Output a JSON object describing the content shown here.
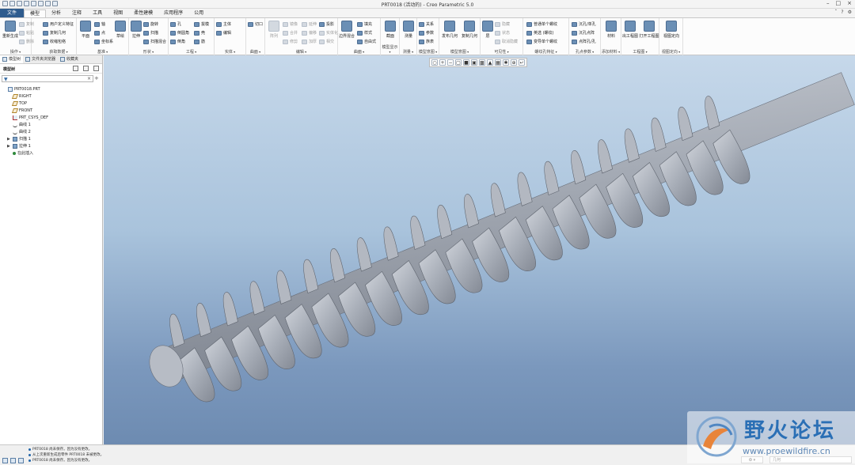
{
  "window": {
    "title": "PRT0018 (活动的) - Creo Parametric 5.0"
  },
  "menu_tabs": [
    {
      "label": "文件",
      "kind": "file"
    },
    {
      "label": "模型",
      "kind": "active"
    },
    {
      "label": "分析"
    },
    {
      "label": "注释"
    },
    {
      "label": "工具"
    },
    {
      "label": "视图"
    },
    {
      "label": "柔性建模"
    },
    {
      "label": "应用程序"
    },
    {
      "label": "公用"
    }
  ],
  "ribbon": {
    "operations": {
      "label": "操作",
      "regen": "重新生成",
      "copy": "复制",
      "paste": "粘贴",
      "delete": "删除"
    },
    "get_data": {
      "label": "获取数据",
      "udf": "用户定义特征",
      "copy_geom": "复制几何",
      "shrinkwrap": "收缩包络"
    },
    "datum": {
      "label": "基准",
      "plane": "平面",
      "axis": "轴",
      "point": "点",
      "csys": "坐标系",
      "sketch": "草绘"
    },
    "shapes": {
      "label": "形状",
      "extrude": "拉伸",
      "revolve": "旋转",
      "sweep": "扫描",
      "swept_blend": "扫描混合"
    },
    "engineering": {
      "label": "工程",
      "hole": "孔",
      "round": "倒圆角",
      "chamfer": "倒角",
      "draft": "拔模",
      "shell": "壳",
      "rib": "筋"
    },
    "solid": {
      "label": "实体",
      "edit": "编辑",
      "advanced": "主体",
      "tab1": "切口"
    },
    "surface": {
      "label": "曲面",
      "fill": "填充",
      "boundary": "边界混合",
      "style": "样式",
      "freestyle": "自由式"
    },
    "editing": {
      "label": "编辑",
      "pattern": "阵列",
      "mirror": "镜像",
      "merge": "合并",
      "trim": "修剪",
      "extend": "延伸",
      "offset": "偏移",
      "thicken": "加厚",
      "solidify": "实体化",
      "intersect": "相交",
      "project": "投影"
    },
    "model_intent": {
      "label": "模型意图",
      "relations": "关系",
      "params": "参数",
      "family": "族表",
      "section": "截面"
    },
    "model_display": {
      "label": "模型显示"
    },
    "measure": {
      "label": "测量",
      "btn": "测量"
    },
    "publish": {
      "label": "模型意图",
      "pub_geom": "发布几何",
      "copy_geom": "复制几何"
    },
    "visibility": {
      "label": "可见性",
      "hide": "隐藏",
      "status": "状态",
      "cancel_hide": "取消隐藏"
    },
    "thread": {
      "label": "螺纹孔特征",
      "normal": "普通单个螺纹",
      "std": "英选 (螺纹)",
      "var": "变导单个螺纹"
    },
    "holes": {
      "label": "孔点参数",
      "hole1": "沉孔/单孔",
      "hole2": "沉孔点阵",
      "hole3": "点阵孔/孔"
    },
    "material": {
      "label": "添加材料",
      "btn": "材料"
    },
    "drawing": {
      "label": "工程图",
      "out": "出工程图",
      "open": "打开工程图"
    },
    "view_orient": {
      "label": "视图定向",
      "btn": "视图定向"
    }
  },
  "panel": {
    "tabs": [
      "模型树",
      "文件夹浏览器",
      "收藏夹"
    ],
    "model_tree_label": "模型树",
    "tree": [
      {
        "label": "PRT0018.PRT",
        "icon": "part",
        "indent": 0
      },
      {
        "label": "RIGHT",
        "icon": "plane",
        "indent": 1
      },
      {
        "label": "TOP",
        "icon": "plane",
        "indent": 1
      },
      {
        "label": "FRONT",
        "icon": "plane",
        "indent": 1
      },
      {
        "label": "PRT_CSYS_DEF",
        "icon": "csys",
        "indent": 1
      },
      {
        "label": "曲线 1",
        "icon": "curve",
        "indent": 1
      },
      {
        "label": "曲线 2",
        "icon": "curve",
        "indent": 1
      },
      {
        "label": "扫描 1",
        "icon": "feat",
        "indent": 1,
        "expand": "▶"
      },
      {
        "label": "拉伸 1",
        "icon": "feat",
        "indent": 1,
        "expand": "▶"
      },
      {
        "label": "在此插入",
        "icon": "insert",
        "indent": 1
      }
    ]
  },
  "status": {
    "messages": [
      "PRT0018 尚未保存。因为没有更改。",
      "从上次重新生成后零件 PRT0018 未被更改。",
      "PRT0018 尚未保存。因为没有更改。"
    ],
    "selection_filter": "几何"
  },
  "watermark": {
    "title": "野火论坛",
    "url": "www.proewildfire.cn"
  },
  "colors": {
    "file_tab": "#2f5c8e",
    "model_metal": "#a4aab4",
    "bg_top": "#c6d8ea",
    "bg_bottom": "#6d8bb1"
  }
}
